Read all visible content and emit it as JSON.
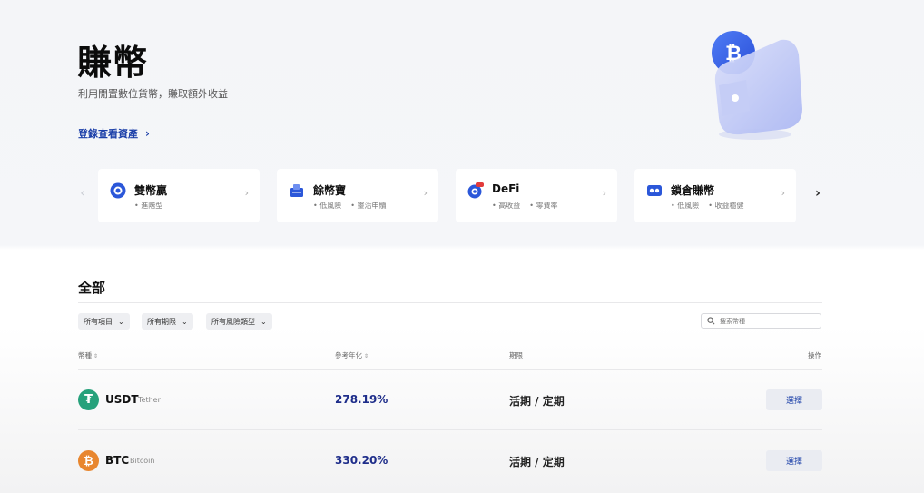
{
  "hero": {
    "title": "賺幣",
    "subtitle": "利用閒置數位貨幣，賺取額外收益",
    "login_link": "登錄查看資產"
  },
  "products": [
    {
      "name": "雙幣贏",
      "tags": [
        "進階型"
      ],
      "icon": "dual-coin-icon"
    },
    {
      "name": "餘幣寶",
      "tags": [
        "低風險",
        "靈活申贖"
      ],
      "icon": "savings-icon"
    },
    {
      "name": "DeFi",
      "tags": [
        "高收益",
        "零費率"
      ],
      "icon": "defi-icon"
    },
    {
      "name": "鎖倉賺幣",
      "tags": [
        "低風險",
        "收益穩健"
      ],
      "icon": "staking-icon"
    }
  ],
  "section": {
    "title": "全部",
    "filters": [
      "所有項目",
      "所有期限",
      "所有風險類型"
    ],
    "search_placeholder": "搜索幣種"
  },
  "table": {
    "headers": {
      "coin": "幣種",
      "apr": "參考年化",
      "term": "期限",
      "action": "操作"
    },
    "rows": [
      {
        "symbol": "USDT",
        "name": "Tether",
        "apr": "278.19%",
        "term": "活期 / 定期",
        "action": "選擇",
        "icon": "tether-icon",
        "color": "#26a17b"
      },
      {
        "symbol": "BTC",
        "name": "Bitcoin",
        "apr": "330.20%",
        "term": "活期 / 定期",
        "action": "選擇",
        "icon": "bitcoin-icon",
        "color": "#e8862f"
      }
    ]
  },
  "colors": {
    "accent": "#1b3fa8",
    "apr": "#1e2d8a"
  }
}
